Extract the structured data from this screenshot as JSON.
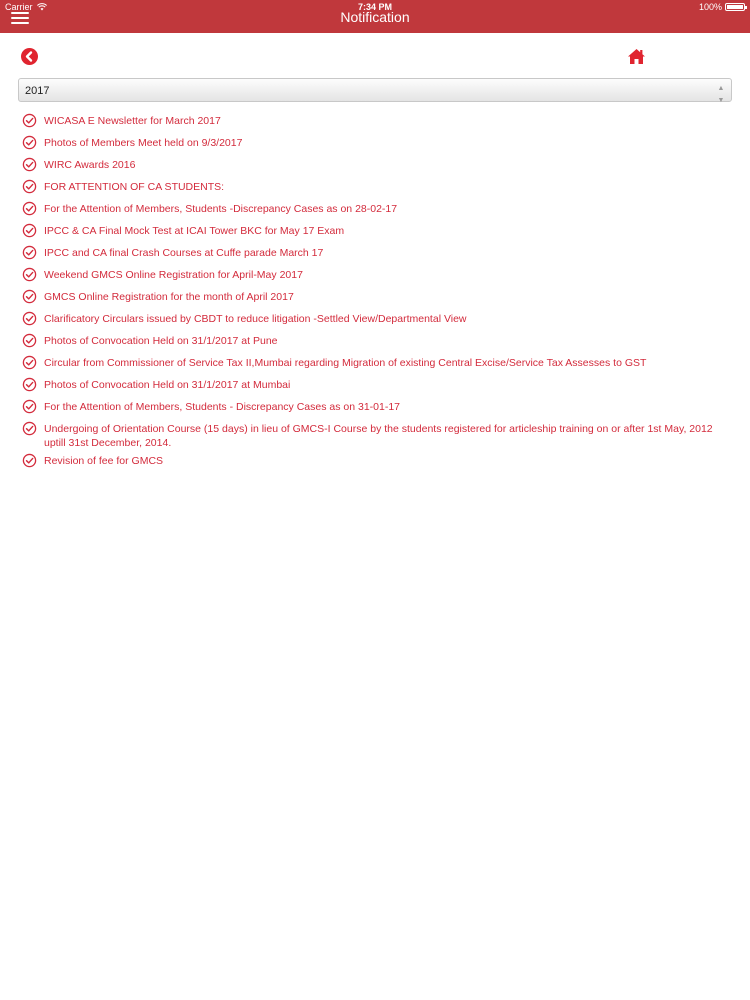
{
  "status_bar": {
    "carrier": "Carrier",
    "time": "7:34 PM",
    "battery": "100%"
  },
  "header": {
    "title": "Notification"
  },
  "filter": {
    "selected_year": "2017"
  },
  "notifications": [
    "WICASA E Newsletter for March 2017",
    "Photos of Members Meet held on 9/3/2017",
    "WIRC Awards 2016",
    "FOR ATTENTION OF CA STUDENTS:",
    "For the Attention of Members, Students -Discrepancy Cases as on 28-02-17",
    "IPCC & CA Final Mock Test at ICAI Tower BKC for May 17 Exam",
    "IPCC and CA final Crash Courses at Cuffe parade March 17",
    "Weekend GMCS Online Registration for April-May 2017",
    "GMCS Online Registration for the month of April 2017",
    "Clarificatory Circulars issued by CBDT to reduce litigation -Settled View/Departmental View",
    "Photos of Convocation Held on 31/1/2017 at Pune",
    "Circular from Commissioner of Service Tax II,Mumbai regarding Migration of existing Central Excise/Service Tax Assesses to GST",
    "Photos of Convocation Held on 31/1/2017 at Mumbai",
    "For the Attention of Members, Students - Discrepancy Cases as on 31-01-17",
    "Undergoing of Orientation Course (15 days) in lieu of GMCS-I Course by the students registered for articleship training on or after 1st May, 2012 uptill 31st December, 2014.",
    "Revision of fee for GMCS"
  ],
  "colors": {
    "header_bg": "#c0383c",
    "accent": "#d32b3c"
  }
}
